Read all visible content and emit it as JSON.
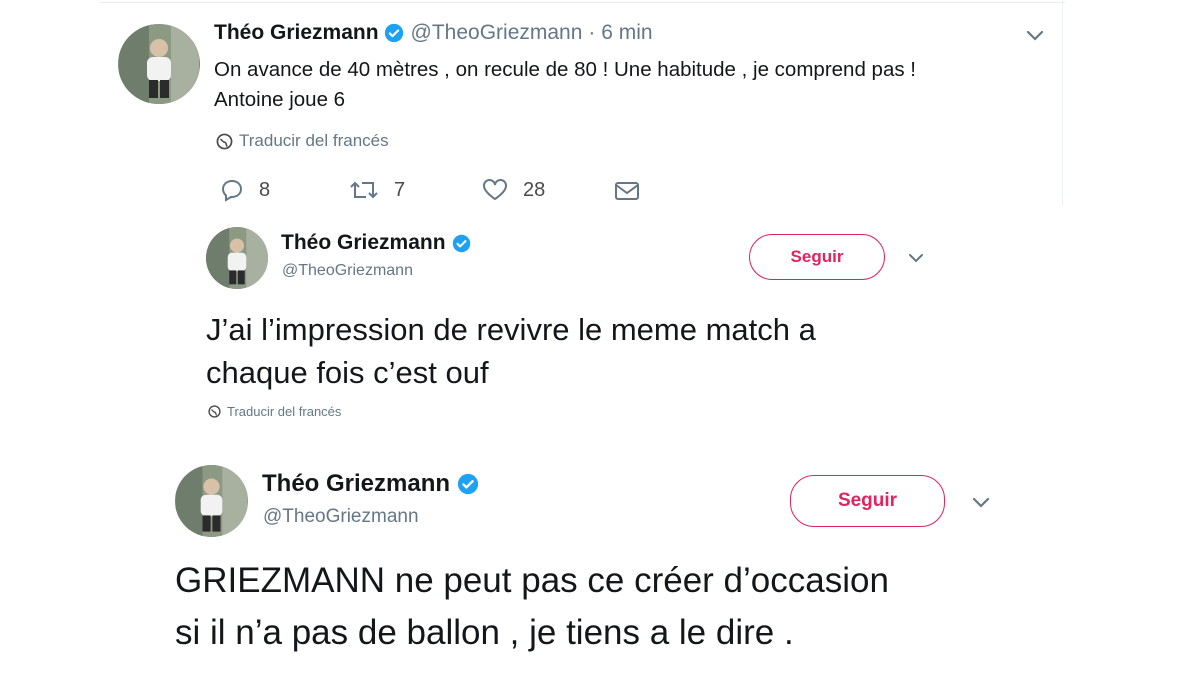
{
  "tweet1": {
    "name": "Théo Griezmann",
    "handle": "@TheoGriezmann",
    "time": "· 6 min",
    "text_line1": "On avance de 40 mètres , on recule de 80 ! Une habitude , je comprend pas !",
    "text_line2": "Antoine joue 6",
    "translate": "Traducir del francés",
    "replies": "8",
    "retweets": "7",
    "likes": "28"
  },
  "tweet2": {
    "name": "Théo Griezmann",
    "handle": "@TheoGriezmann",
    "follow_label": "Seguir",
    "text_line1": "J’ai l’impression de revivre le meme  match a",
    "text_line2": "chaque fois c’est ouf",
    "translate": "Traducir del francés"
  },
  "tweet3": {
    "name": "Théo Griezmann",
    "handle": "@TheoGriezmann",
    "follow_label": "Seguir",
    "text_line1": "GRIEZMANN ne peut pas ce créer d’occasion",
    "text_line2": "si il n’a pas de ballon , je tiens a le dire ."
  },
  "colors": {
    "verified": "#1da1f2",
    "follow": "#e0245e",
    "muted": "#657786",
    "text": "#14171a"
  },
  "icons": [
    "chevron-down-icon",
    "verified-badge-icon",
    "globe-icon",
    "reply-icon",
    "retweet-icon",
    "like-icon",
    "message-icon"
  ]
}
